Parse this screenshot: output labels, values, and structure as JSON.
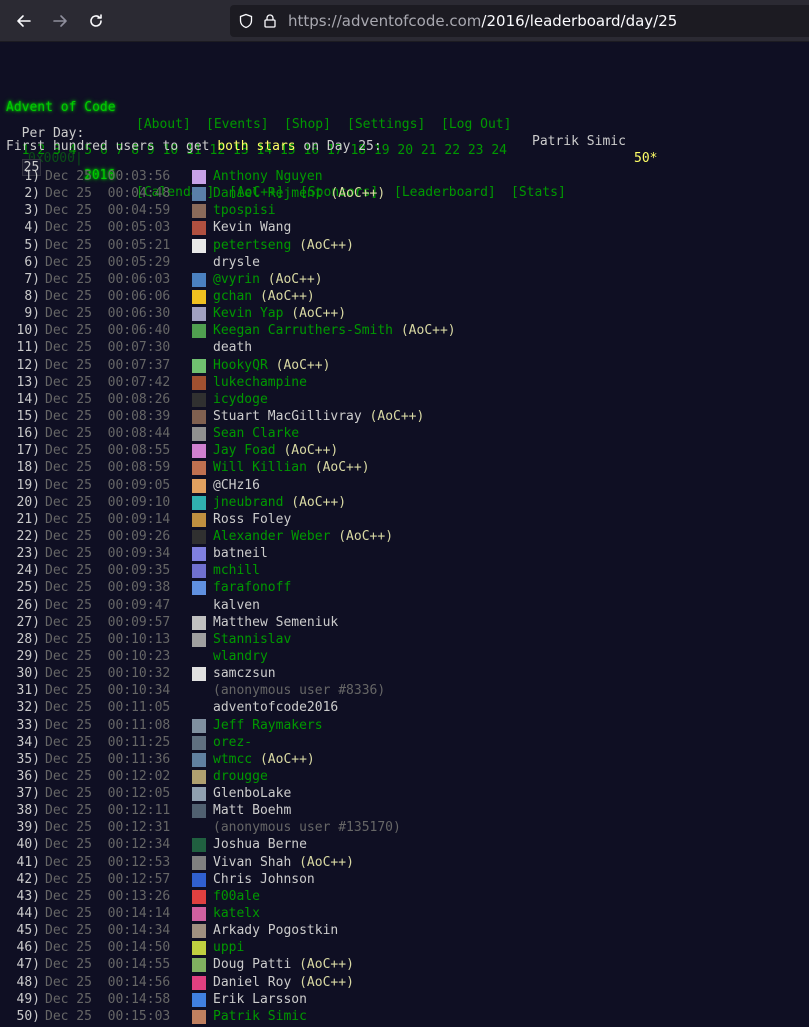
{
  "browser": {
    "url_host": "https://adventofcode.com",
    "url_path": "/2016/leaderboard/day/25"
  },
  "header": {
    "title": "Advent of Code",
    "year_prefix": "0x0000|",
    "year": "2016",
    "nav_row1": [
      "[About]",
      "[Events]",
      "[Shop]",
      "[Settings]",
      "[Log Out]"
    ],
    "user_name": "Patrik Simic",
    "user_stars": "50*",
    "nav_row2": [
      "[Calendar]",
      "[AoC++]",
      "[Sponsors]",
      "[Leaderboard]",
      "[Stats]"
    ]
  },
  "per_day": {
    "label": "Per Day:",
    "days": [
      "1",
      "2",
      "3",
      "4",
      "5",
      "6",
      "7",
      "8",
      "9",
      "10",
      "11",
      "12",
      "13",
      "14",
      "15",
      "16",
      "17",
      "18",
      "19",
      "20",
      "21",
      "22",
      "23",
      "24"
    ],
    "current": "25"
  },
  "intro": {
    "prefix": "First hundred users to get ",
    "highlight": "both stars",
    "suffix": " on Day 25:"
  },
  "supporter_tag": "(AoC++)",
  "entries": [
    {
      "pos": "1)",
      "date": "Dec 25  00:03:56",
      "name": "Anthony Nguyen",
      "linked": true,
      "supp": false,
      "avatar": "#c8a2e8"
    },
    {
      "pos": "2)",
      "date": "Dec 25  00:04:48",
      "name": "Daniel Rejment",
      "linked": true,
      "supp": true,
      "avatar": "#5a7fa8"
    },
    {
      "pos": "3)",
      "date": "Dec 25  00:04:59",
      "name": "tpospisi",
      "linked": true,
      "supp": false,
      "avatar": "#8a6a5a"
    },
    {
      "pos": "4)",
      "date": "Dec 25  00:05:03",
      "name": "Kevin Wang",
      "linked": false,
      "supp": false,
      "avatar": "#b05040"
    },
    {
      "pos": "5)",
      "date": "Dec 25  00:05:21",
      "name": "petertseng",
      "linked": true,
      "supp": true,
      "avatar": "#e8e8e8"
    },
    {
      "pos": "6)",
      "date": "Dec 25  00:05:29",
      "name": "drysle",
      "linked": false,
      "supp": false,
      "avatar": ""
    },
    {
      "pos": "7)",
      "date": "Dec 25  00:06:03",
      "name": "@vyrin",
      "linked": true,
      "supp": true,
      "avatar": "#4a80c0"
    },
    {
      "pos": "8)",
      "date": "Dec 25  00:06:06",
      "name": "gchan",
      "linked": true,
      "supp": true,
      "avatar": "#f0c020"
    },
    {
      "pos": "9)",
      "date": "Dec 25  00:06:30",
      "name": "Kevin Yap",
      "linked": true,
      "supp": true,
      "avatar": "#a0a0c0"
    },
    {
      "pos": "10)",
      "date": "Dec 25  00:06:40",
      "name": "Keegan Carruthers-Smith",
      "linked": true,
      "supp": true,
      "avatar": "#50a050"
    },
    {
      "pos": "11)",
      "date": "Dec 25  00:07:30",
      "name": "death",
      "linked": false,
      "supp": false,
      "avatar": ""
    },
    {
      "pos": "12)",
      "date": "Dec 25  00:07:37",
      "name": "HookyQR",
      "linked": true,
      "supp": true,
      "avatar": "#70c070"
    },
    {
      "pos": "13)",
      "date": "Dec 25  00:07:42",
      "name": "lukechampine",
      "linked": true,
      "supp": false,
      "avatar": "#a05030"
    },
    {
      "pos": "14)",
      "date": "Dec 25  00:08:26",
      "name": "icydoge",
      "linked": true,
      "supp": false,
      "avatar": "#303030"
    },
    {
      "pos": "15)",
      "date": "Dec 25  00:08:39",
      "name": "Stuart MacGillivray",
      "linked": false,
      "supp": true,
      "avatar": "#806050"
    },
    {
      "pos": "16)",
      "date": "Dec 25  00:08:44",
      "name": "Sean Clarke",
      "linked": true,
      "supp": false,
      "avatar": "#909090"
    },
    {
      "pos": "17)",
      "date": "Dec 25  00:08:55",
      "name": "Jay Foad",
      "linked": true,
      "supp": true,
      "avatar": "#d080d0"
    },
    {
      "pos": "18)",
      "date": "Dec 25  00:08:59",
      "name": "Will Killian",
      "linked": true,
      "supp": true,
      "avatar": "#c07050"
    },
    {
      "pos": "19)",
      "date": "Dec 25  00:09:05",
      "name": "@CHz16",
      "linked": false,
      "supp": false,
      "avatar": "#e0a060"
    },
    {
      "pos": "20)",
      "date": "Dec 25  00:09:10",
      "name": "jneubrand",
      "linked": true,
      "supp": true,
      "avatar": "#30b0b0"
    },
    {
      "pos": "21)",
      "date": "Dec 25  00:09:14",
      "name": "Ross Foley",
      "linked": false,
      "supp": false,
      "avatar": "#c09040"
    },
    {
      "pos": "22)",
      "date": "Dec 25  00:09:26",
      "name": "Alexander Weber",
      "linked": true,
      "supp": true,
      "avatar": "#303030"
    },
    {
      "pos": "23)",
      "date": "Dec 25  00:09:34",
      "name": "batneil",
      "linked": false,
      "supp": false,
      "avatar": "#8080e0"
    },
    {
      "pos": "24)",
      "date": "Dec 25  00:09:35",
      "name": "mchill",
      "linked": true,
      "supp": false,
      "avatar": "#7070d0"
    },
    {
      "pos": "25)",
      "date": "Dec 25  00:09:38",
      "name": "farafonoff",
      "linked": true,
      "supp": false,
      "avatar": "#6090e0"
    },
    {
      "pos": "26)",
      "date": "Dec 25  00:09:47",
      "name": "kalven",
      "linked": false,
      "supp": false,
      "avatar": ""
    },
    {
      "pos": "27)",
      "date": "Dec 25  00:09:57",
      "name": "Matthew Semeniuk",
      "linked": false,
      "supp": false,
      "avatar": "#c0c0c0"
    },
    {
      "pos": "28)",
      "date": "Dec 25  00:10:13",
      "name": "Stannislav",
      "linked": true,
      "supp": false,
      "avatar": "#a0a0a0"
    },
    {
      "pos": "29)",
      "date": "Dec 25  00:10:23",
      "name": "wlandry",
      "linked": true,
      "supp": false,
      "avatar": ""
    },
    {
      "pos": "30)",
      "date": "Dec 25  00:10:32",
      "name": "samczsun",
      "linked": false,
      "supp": false,
      "avatar": "#e0e0e0"
    },
    {
      "pos": "31)",
      "date": "Dec 25  00:10:34",
      "name": "(anonymous user #8336)",
      "linked": false,
      "anon": true,
      "supp": false,
      "avatar": ""
    },
    {
      "pos": "32)",
      "date": "Dec 25  00:11:05",
      "name": "adventofcode2016",
      "linked": false,
      "supp": false,
      "avatar": ""
    },
    {
      "pos": "33)",
      "date": "Dec 25  00:11:08",
      "name": "Jeff Raymakers",
      "linked": true,
      "supp": false,
      "avatar": "#8090a0"
    },
    {
      "pos": "34)",
      "date": "Dec 25  00:11:25",
      "name": "orez-",
      "linked": true,
      "supp": false,
      "avatar": "#607080"
    },
    {
      "pos": "35)",
      "date": "Dec 25  00:11:36",
      "name": "wtmcc",
      "linked": true,
      "supp": true,
      "avatar": "#6080a0"
    },
    {
      "pos": "36)",
      "date": "Dec 25  00:12:02",
      "name": "drougge",
      "linked": true,
      "supp": false,
      "avatar": "#b0a070"
    },
    {
      "pos": "37)",
      "date": "Dec 25  00:12:05",
      "name": "GlenboLake",
      "linked": false,
      "supp": false,
      "avatar": "#90a0b0"
    },
    {
      "pos": "38)",
      "date": "Dec 25  00:12:11",
      "name": "Matt Boehm",
      "linked": false,
      "supp": false,
      "avatar": "#506070"
    },
    {
      "pos": "39)",
      "date": "Dec 25  00:12:31",
      "name": "(anonymous user #135170)",
      "linked": false,
      "anon": true,
      "supp": false,
      "avatar": ""
    },
    {
      "pos": "40)",
      "date": "Dec 25  00:12:34",
      "name": "Joshua Berne",
      "linked": false,
      "supp": false,
      "avatar": "#206040"
    },
    {
      "pos": "41)",
      "date": "Dec 25  00:12:53",
      "name": "Vivan Shah",
      "linked": false,
      "supp": true,
      "avatar": "#808080"
    },
    {
      "pos": "42)",
      "date": "Dec 25  00:12:57",
      "name": "Chris Johnson",
      "linked": false,
      "supp": false,
      "avatar": "#3060d0"
    },
    {
      "pos": "43)",
      "date": "Dec 25  00:13:26",
      "name": "f00ale",
      "linked": true,
      "supp": false,
      "avatar": "#e04040"
    },
    {
      "pos": "44)",
      "date": "Dec 25  00:14:14",
      "name": "katelx",
      "linked": true,
      "supp": false,
      "avatar": "#d060a0"
    },
    {
      "pos": "45)",
      "date": "Dec 25  00:14:34",
      "name": "Arkady Pogostkin",
      "linked": false,
      "supp": false,
      "avatar": "#a09080"
    },
    {
      "pos": "46)",
      "date": "Dec 25  00:14:50",
      "name": "uppi",
      "linked": true,
      "supp": false,
      "avatar": "#c0d040"
    },
    {
      "pos": "47)",
      "date": "Dec 25  00:14:55",
      "name": "Doug Patti",
      "linked": false,
      "supp": true,
      "avatar": "#80b060"
    },
    {
      "pos": "48)",
      "date": "Dec 25  00:14:56",
      "name": "Daniel Roy",
      "linked": false,
      "supp": true,
      "avatar": "#e04080"
    },
    {
      "pos": "49)",
      "date": "Dec 25  00:14:58",
      "name": "Erik Larsson",
      "linked": false,
      "supp": false,
      "avatar": "#4080e0"
    },
    {
      "pos": "50)",
      "date": "Dec 25  00:15:03",
      "name": "Patrik Simic",
      "linked": true,
      "supp": false,
      "avatar": "#c08060"
    }
  ]
}
